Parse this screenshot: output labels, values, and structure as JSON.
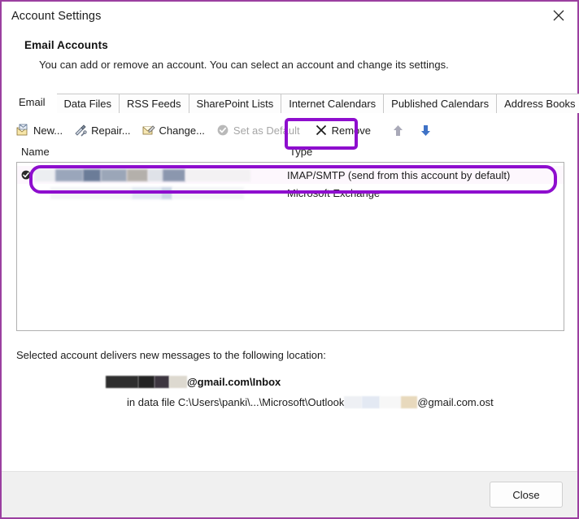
{
  "window": {
    "title": "Account Settings",
    "close_icon": "close-x-icon",
    "accent_border": "#9b3fa0",
    "annotation_color": "#8e0ece"
  },
  "header": {
    "title": "Email Accounts",
    "description": "You can add or remove an account. You can select an account and change its settings."
  },
  "tabs": [
    {
      "label": "Email",
      "active": true
    },
    {
      "label": "Data Files",
      "active": false
    },
    {
      "label": "RSS Feeds",
      "active": false
    },
    {
      "label": "SharePoint Lists",
      "active": false
    },
    {
      "label": "Internet Calendars",
      "active": false
    },
    {
      "label": "Published Calendars",
      "active": false
    },
    {
      "label": "Address Books",
      "active": false
    }
  ],
  "toolbar": {
    "buttons": [
      {
        "label": "New...",
        "icon": "new-mail-icon",
        "enabled": true
      },
      {
        "label": "Repair...",
        "icon": "repair-tools-icon",
        "enabled": true
      },
      {
        "label": "Change...",
        "icon": "change-account-icon",
        "enabled": true
      },
      {
        "label": "Set as Default",
        "icon": "set-default-check-icon",
        "enabled": false
      },
      {
        "label": "Remove",
        "icon": "remove-x-icon",
        "enabled": true,
        "highlighted": true
      }
    ],
    "move_up": {
      "icon": "arrow-up-icon",
      "enabled": false,
      "color": "#a7a7b5"
    },
    "move_down": {
      "icon": "arrow-down-icon",
      "enabled": true,
      "color": "#3a6fc4"
    }
  },
  "accounts_list": {
    "columns": [
      "Name",
      "Type"
    ],
    "rows": [
      {
        "name": "",
        "name_redacted": true,
        "type": "IMAP/SMTP (send from this account by default)",
        "selected": true,
        "default_icon": "default-account-check-icon",
        "highlighted": true
      },
      {
        "name": "",
        "name_redacted": true,
        "type": "Microsoft Exchange",
        "selected": false,
        "default_icon": "",
        "highlighted": false
      }
    ]
  },
  "delivery": {
    "label": "Selected account delivers new messages to the following location:",
    "mailbox_suffix": "@gmail.com\\Inbox",
    "datafile_prefix": "in data file C:\\Users\\panki\\...\\Microsoft\\Outlook",
    "datafile_suffix": "@gmail.com.ost"
  },
  "footer": {
    "close_label": "Close"
  }
}
